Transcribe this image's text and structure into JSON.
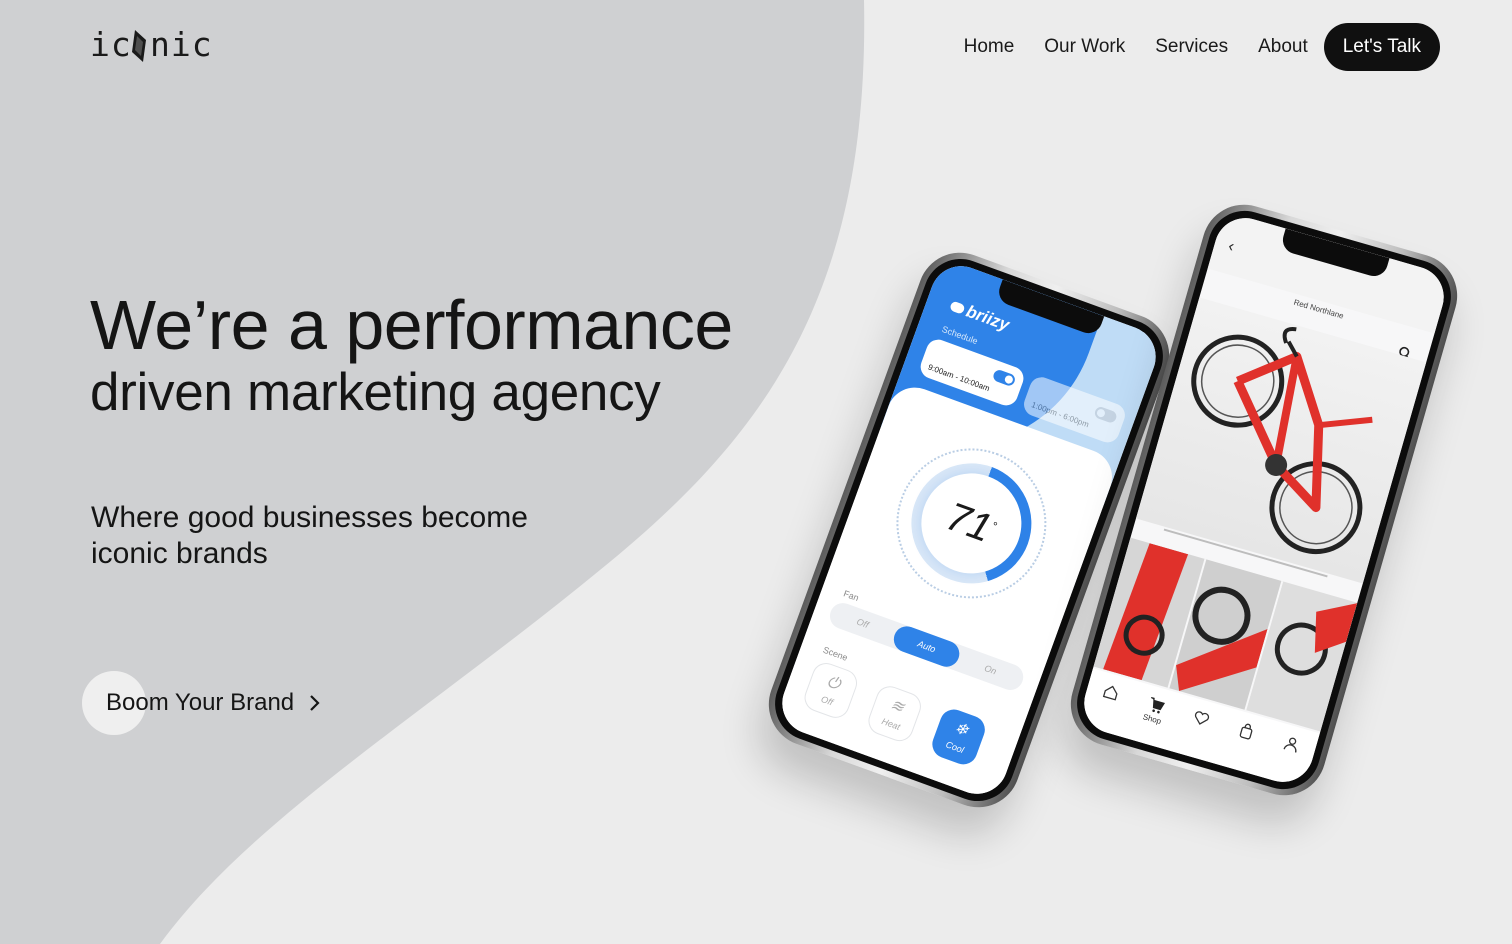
{
  "brand": {
    "logo_text": "ic nic"
  },
  "nav": {
    "links": [
      {
        "label": "Home"
      },
      {
        "label": "Our Work"
      },
      {
        "label": "Services"
      },
      {
        "label": "About"
      }
    ],
    "cta_label": "Let's Talk"
  },
  "hero": {
    "line1": "We’re a performance",
    "line2": "driven marketing agency",
    "tagline": "Where good businesses become iconic brands",
    "button_label": "Boom Your Brand"
  },
  "colors": {
    "background": "#ececec",
    "shape": "#cfd0d2",
    "text": "#151515",
    "cta_background": "#101010",
    "app_accent": "#2f83e8",
    "bike_red": "#e0312b"
  },
  "phone_thermostat": {
    "app_name": "briizy",
    "schedule_label": "Schedule",
    "schedule_a_time": "9:00am - 10:00am",
    "schedule_b_time": "1:00pm - 6:00pm",
    "temperature": "71",
    "fan_label": "Fan",
    "fan_options": [
      {
        "label": "Off"
      },
      {
        "label": "Auto"
      },
      {
        "label": "On"
      }
    ],
    "fan_selected": "Auto",
    "scene_label": "Scene",
    "scenes": [
      {
        "label": "Off",
        "icon": "power-icon"
      },
      {
        "label": "Heat",
        "icon": "heat-icon"
      },
      {
        "label": "Cool",
        "icon": "snowflake-icon"
      }
    ],
    "scene_selected": "Cool"
  },
  "phone_shop": {
    "product_title": "Red Northlane",
    "tabs": [
      {
        "label": "",
        "icon": "home-icon"
      },
      {
        "label": "Shop",
        "icon": "cart-icon"
      },
      {
        "label": "",
        "icon": "heart-icon"
      },
      {
        "label": "",
        "icon": "bag-icon"
      },
      {
        "label": "",
        "icon": "user-icon"
      }
    ]
  }
}
